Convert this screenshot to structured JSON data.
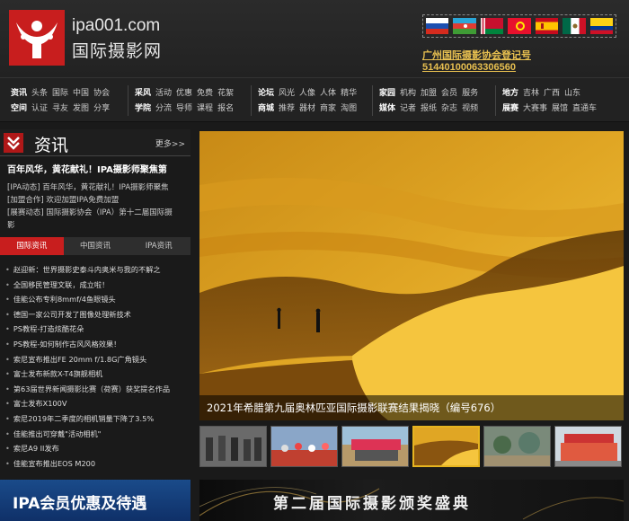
{
  "header": {
    "domain": "ipa001.com",
    "site_name": "国际摄影网",
    "registration_line1": "广州国际摄影协会登记号",
    "registration_line2": "51440100063306560",
    "flags": [
      "russia-flag",
      "azerbaijan-flag",
      "belarus-flag",
      "kyrgyzstan-flag",
      "spain-flag",
      "mexico-flag",
      "colombia-flag"
    ]
  },
  "nav": {
    "groups": [
      {
        "rows": [
          [
            "资讯",
            "头条",
            "国际",
            "中国",
            "协会"
          ],
          [
            "空间",
            "认证",
            "寻友",
            "发图",
            "分享"
          ]
        ]
      },
      {
        "rows": [
          [
            "采风",
            "活动",
            "优惠",
            "免费",
            "花絮"
          ],
          [
            "学院",
            "分流",
            "导师",
            "课程",
            "报名"
          ]
        ]
      },
      {
        "rows": [
          [
            "论坛",
            "风光",
            "人像",
            "人体",
            "精华"
          ],
          [
            "商城",
            "推荐",
            "器材",
            "商家",
            "淘图"
          ]
        ]
      },
      {
        "rows": [
          [
            "家园",
            "机构",
            "加盟",
            "会员",
            "服务"
          ],
          [
            "媒体",
            "记者",
            "报纸",
            "杂志",
            "视频"
          ]
        ]
      },
      {
        "rows": [
          [
            "地方",
            "吉林",
            "广西",
            "山东"
          ],
          [
            "展赛",
            "大赛事",
            "展馆",
            "直通车"
          ]
        ]
      }
    ]
  },
  "news": {
    "title": "资讯",
    "more": "更多>>",
    "headline": "百年风华，黄花献礼！IPA摄影师聚焦第",
    "top_links": [
      "[IPA动态] 百年风华，黄花献礼！IPA摄影师聚焦",
      "[加盟合作] 欢迎加盟IPA免费加盟",
      "[展赛动态] 国际摄影协会（IPA）第十二届国际摄",
      "影"
    ],
    "tabs": [
      "国际资讯",
      "中国资讯",
      "IPA资讯"
    ],
    "items": [
      "赵迎新：世界摄影史泰斗内奥米与我的不解之",
      "全国移民管理文联，成立啦！",
      "佳能公布专利8mmf/4鱼眼镜头",
      "德国一家公司开发了图像处理新技术",
      "PS教程-打造炫酷花朵",
      "PS教程-如何制作古风风格效果！",
      "索尼宣布推出FE 20mm f/1.8G广角镜头",
      "富士发布新款X-T4旗舰相机",
      "第63届世界新闻摄影比赛（荷赛）获奖提名作品",
      "富士发布X100V",
      "索尼2019年二季度的相机销量下降了3.5%",
      "佳能推出可穿戴\"活动相机\"",
      "索尼A9 II发布",
      "佳能宣布推出EOS M200"
    ]
  },
  "hero": {
    "caption": "2021年希腊第九届奥林匹亚国际摄影联赛结果揭晓（编号676）"
  },
  "banners": {
    "vip": "IPA会员优惠及待遇",
    "award": "第二届国际摄影颁奖盛典"
  }
}
